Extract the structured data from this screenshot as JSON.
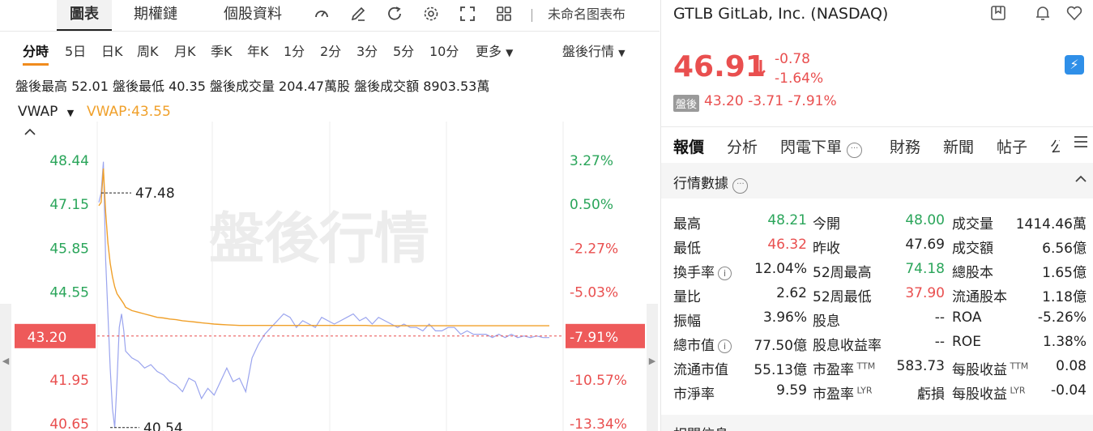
{
  "toolbar": {
    "tabs": [
      "圖表",
      "期權鏈",
      "個股資料"
    ],
    "chart_name": "未命名图表布"
  },
  "periods": [
    "分時",
    "5日",
    "日K",
    "周K",
    "月K",
    "季K",
    "年K",
    "1分",
    "2分",
    "3分",
    "5分",
    "10分",
    "更多"
  ],
  "session_select": "盤後行情",
  "stats": "盤後最高 52.01  盤後最低 40.35  盤後成交量 204.47萬股  盤後成交額 8903.53萬",
  "indicator": {
    "name": "VWAP",
    "value_label": "VWAP:43.55"
  },
  "watermark": "盤後行情",
  "chart_data": {
    "type": "line",
    "y_left_ticks": [
      "48.44",
      "47.15",
      "45.85",
      "44.55",
      "43.20",
      "41.95",
      "40.65"
    ],
    "y_right_ticks": [
      "3.27%",
      "0.50%",
      "-2.27%",
      "-5.03%",
      "-7.91%",
      "-10.57%",
      "-13.34%"
    ],
    "current_price_label": "43.20",
    "current_pct_label": "-7.91%",
    "annotations": {
      "high": "47.48",
      "low": "40.54"
    },
    "series": [
      {
        "color": "#9aa4ee",
        "values": [
          47.2,
          47.48,
          48.4,
          45.5,
          43.9,
          42.3,
          41.1,
          40.54,
          41.9,
          43.5,
          43.9,
          43.4,
          42.8,
          42.6,
          42.5,
          42.3,
          42.4,
          42.2,
          42.1,
          41.9,
          41.8,
          41.6,
          42.0,
          41.9,
          41.4,
          41.7,
          41.5,
          41.9,
          42.3,
          41.9,
          42.0,
          41.6,
          42.6,
          43.0,
          43.3,
          43.5,
          43.7,
          43.9,
          43.8,
          43.5,
          43.7,
          43.6,
          43.5,
          43.8,
          43.7,
          43.6,
          43.7,
          43.8,
          43.9,
          43.7,
          43.8,
          43.6,
          43.8,
          43.7,
          43.6,
          43.5,
          43.6,
          43.5,
          43.5,
          43.4,
          43.6,
          43.4,
          43.4,
          43.5,
          43.5,
          43.3,
          43.4,
          43.3,
          43.3,
          43.3,
          43.2,
          43.3,
          43.2,
          43.3,
          43.2,
          43.25,
          43.2,
          43.25,
          43.2,
          43.2
        ]
      },
      {
        "name": "VWAP",
        "color": "#f0a02a",
        "values": [
          47.1,
          47.2,
          48.2,
          46.9,
          46.0,
          45.4,
          45.0,
          44.7,
          44.5,
          44.4,
          44.3,
          44.2,
          44.1,
          44.0,
          43.95,
          43.9,
          43.85,
          43.8,
          43.78,
          43.75,
          43.73,
          43.7,
          43.68,
          43.66,
          43.64,
          43.62,
          43.6,
          43.59,
          43.58,
          43.57,
          43.56,
          43.56,
          43.56,
          43.56,
          43.56,
          43.56,
          43.56,
          43.56,
          43.56,
          43.56,
          43.56,
          43.56,
          43.56,
          43.56,
          43.56,
          43.56,
          43.56,
          43.56,
          43.56,
          43.56,
          43.56,
          43.55,
          43.55,
          43.55,
          43.55,
          43.55,
          43.55,
          43.55,
          43.55,
          43.55,
          43.55,
          43.55,
          43.55,
          43.55,
          43.55,
          43.55,
          43.55,
          43.55,
          43.55,
          43.55,
          43.55,
          43.55,
          43.55,
          43.55,
          43.55,
          43.55,
          43.55,
          43.55,
          43.55,
          43.55
        ]
      }
    ],
    "ylim": [
      40.4,
      49.6
    ],
    "grid": true
  },
  "quote": {
    "title": "GTLB GitLab, Inc. (NASDAQ)",
    "price": "46.91",
    "change": "-0.78",
    "change_pct": "-1.64%",
    "ah_badge": "盤後",
    "ah_values": "43.20  -3.71  -7.91%"
  },
  "right_tabs": [
    "報價",
    "分析",
    "閃電下單",
    "財務",
    "新聞",
    "帖子",
    "公"
  ],
  "section_title": "行情數據",
  "bottom_section": "相關信息",
  "rows": [
    [
      {
        "l": "最高",
        "v": "48.21",
        "c": "green"
      },
      {
        "l": "今開",
        "v": "48.00",
        "c": "green"
      },
      {
        "l": "成交量",
        "v": "1414.46萬",
        "c": ""
      }
    ],
    [
      {
        "l": "最低",
        "v": "46.32",
        "c": "red"
      },
      {
        "l": "昨收",
        "v": "47.69",
        "c": ""
      },
      {
        "l": "成交額",
        "v": "6.56億",
        "c": ""
      }
    ],
    [
      {
        "l": "換手率",
        "v": "12.04%",
        "c": "",
        "i": true
      },
      {
        "l": "52周最高",
        "v": "74.18",
        "c": "green"
      },
      {
        "l": "總股本",
        "v": "1.65億",
        "c": ""
      }
    ],
    [
      {
        "l": "量比",
        "v": "2.62",
        "c": ""
      },
      {
        "l": "52周最低",
        "v": "37.90",
        "c": "red"
      },
      {
        "l": "流通股本",
        "v": "1.18億",
        "c": ""
      }
    ],
    [
      {
        "l": "振幅",
        "v": "3.96%",
        "c": ""
      },
      {
        "l": "股息",
        "v": "--",
        "c": ""
      },
      {
        "l": "ROA",
        "v": "-5.26%",
        "c": ""
      }
    ],
    [
      {
        "l": "總市值",
        "v": "77.50億",
        "c": "",
        "i": true
      },
      {
        "l": "股息收益率",
        "v": "--",
        "c": ""
      },
      {
        "l": "ROE",
        "v": "1.38%",
        "c": ""
      }
    ],
    [
      {
        "l": "流通市值",
        "v": "55.13億",
        "c": ""
      },
      {
        "l": "市盈率",
        "s": "TTM",
        "v": "583.73",
        "c": ""
      },
      {
        "l": "每股收益",
        "s": "TTM",
        "v": "0.08",
        "c": ""
      }
    ],
    [
      {
        "l": "市淨率",
        "v": "9.59",
        "c": ""
      },
      {
        "l": "市盈率",
        "s": "LYR",
        "v": "虧損",
        "c": ""
      },
      {
        "l": "每股收益",
        "s": "LYR",
        "v": "-0.04",
        "c": ""
      }
    ]
  ]
}
